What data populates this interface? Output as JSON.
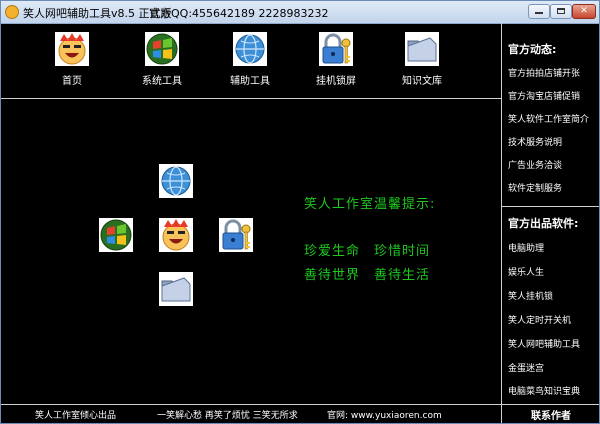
{
  "window": {
    "title": "笑人网吧辅助工具v8.5 正式版",
    "qq": "官方QQ:455642189 2228983232"
  },
  "toolbar": {
    "items": [
      {
        "label": "首页",
        "icon": "smiley-face-icon"
      },
      {
        "label": "系统工具",
        "icon": "windows-logo-icon"
      },
      {
        "label": "辅助工具",
        "icon": "globe-icon"
      },
      {
        "label": "挂机锁屏",
        "icon": "lock-key-icon"
      },
      {
        "label": "知识文库",
        "icon": "folder-icon"
      }
    ]
  },
  "sidebar": {
    "news_title": "官方动态:",
    "news_items": [
      "官方拍拍店铺开张",
      "官方淘宝店铺促销",
      "笑人软件工作室简介",
      "技术服务说明",
      "广告业务洽谈",
      "软件定制服务"
    ],
    "products_title": "官方出品软件:",
    "product_items": [
      "电脑助理",
      "娱乐人生",
      "笑人挂机锁",
      "笑人定时开关机",
      "笑人网吧辅助工具",
      "金蛋迷宫",
      "电脑菜鸟知识宝典"
    ]
  },
  "tips": {
    "heading": "笑人工作室温馨提示:",
    "line1a": "珍爱生命",
    "line1b": "珍惜时间",
    "line2a": "善待世界",
    "line2b": "善待生活"
  },
  "footer": {
    "credit": "笑人工作室倾心出品",
    "slogan": "一笑解心愁 再笑了烦忧 三笑无所求",
    "site": "官网: www.yuxiaoren.com",
    "contact": "联系作者"
  },
  "colors": {
    "background": "#000000",
    "tip_green": "#1ec81e",
    "text": "#ffffff"
  }
}
